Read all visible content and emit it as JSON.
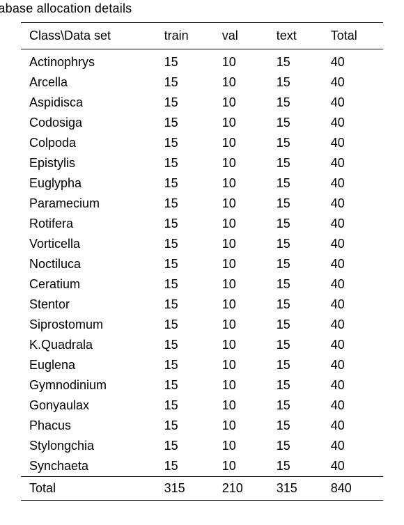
{
  "caption": "atabase allocation details",
  "table": {
    "headers": [
      "Class\\Data set",
      "train",
      "val",
      "text",
      "Total"
    ],
    "rows": [
      {
        "class": "Actinophrys",
        "train": 15,
        "val": 10,
        "text": 15,
        "total": 40
      },
      {
        "class": "Arcella",
        "train": 15,
        "val": 10,
        "text": 15,
        "total": 40
      },
      {
        "class": "Aspidisca",
        "train": 15,
        "val": 10,
        "text": 15,
        "total": 40
      },
      {
        "class": "Codosiga",
        "train": 15,
        "val": 10,
        "text": 15,
        "total": 40
      },
      {
        "class": "Colpoda",
        "train": 15,
        "val": 10,
        "text": 15,
        "total": 40
      },
      {
        "class": "Epistylis",
        "train": 15,
        "val": 10,
        "text": 15,
        "total": 40
      },
      {
        "class": "Euglypha",
        "train": 15,
        "val": 10,
        "text": 15,
        "total": 40
      },
      {
        "class": "Paramecium",
        "train": 15,
        "val": 10,
        "text": 15,
        "total": 40
      },
      {
        "class": "Rotifera",
        "train": 15,
        "val": 10,
        "text": 15,
        "total": 40
      },
      {
        "class": "Vorticella",
        "train": 15,
        "val": 10,
        "text": 15,
        "total": 40
      },
      {
        "class": "Noctiluca",
        "train": 15,
        "val": 10,
        "text": 15,
        "total": 40
      },
      {
        "class": "Ceratium",
        "train": 15,
        "val": 10,
        "text": 15,
        "total": 40
      },
      {
        "class": "Stentor",
        "train": 15,
        "val": 10,
        "text": 15,
        "total": 40
      },
      {
        "class": "Siprostomum",
        "train": 15,
        "val": 10,
        "text": 15,
        "total": 40
      },
      {
        "class": "K.Quadrala",
        "train": 15,
        "val": 10,
        "text": 15,
        "total": 40
      },
      {
        "class": "Euglena",
        "train": 15,
        "val": 10,
        "text": 15,
        "total": 40
      },
      {
        "class": "Gymnodinium",
        "train": 15,
        "val": 10,
        "text": 15,
        "total": 40
      },
      {
        "class": "Gonyaulax",
        "train": 15,
        "val": 10,
        "text": 15,
        "total": 40
      },
      {
        "class": "Phacus",
        "train": 15,
        "val": 10,
        "text": 15,
        "total": 40
      },
      {
        "class": "Stylongchia",
        "train": 15,
        "val": 10,
        "text": 15,
        "total": 40
      },
      {
        "class": "Synchaeta",
        "train": 15,
        "val": 10,
        "text": 15,
        "total": 40
      }
    ],
    "totals": {
      "class": "Total",
      "train": 315,
      "val": 210,
      "text": 315,
      "total": 840
    }
  }
}
